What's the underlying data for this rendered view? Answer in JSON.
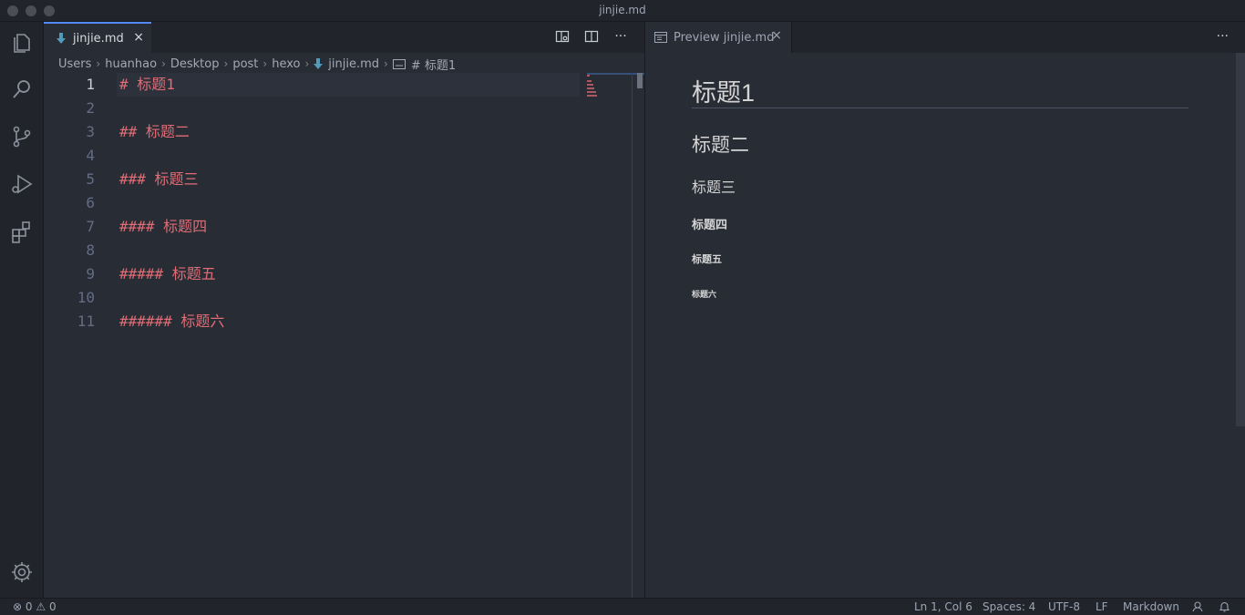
{
  "window": {
    "title": "jinjie.md"
  },
  "activity_bar": {
    "items": [
      "explorer-icon",
      "search-icon",
      "source-control-icon",
      "run-debug-icon",
      "extensions-icon"
    ],
    "bottom": "gear-icon"
  },
  "left_editor": {
    "tab": {
      "label": "jinjie.md",
      "close": "×"
    },
    "more": "···",
    "breadcrumb": {
      "items": [
        "Users",
        "huanhao",
        "Desktop",
        "post",
        "hexo"
      ],
      "file": "jinjie.md",
      "symbol": "# 标题1"
    },
    "lines": [
      {
        "num": "1",
        "text": "# 标题1"
      },
      {
        "num": "2",
        "text": ""
      },
      {
        "num": "3",
        "text": "## 标题二"
      },
      {
        "num": "4",
        "text": ""
      },
      {
        "num": "5",
        "text": "### 标题三"
      },
      {
        "num": "6",
        "text": ""
      },
      {
        "num": "7",
        "text": "#### 标题四"
      },
      {
        "num": "8",
        "text": ""
      },
      {
        "num": "9",
        "text": "##### 标题五"
      },
      {
        "num": "10",
        "text": ""
      },
      {
        "num": "11",
        "text": "###### 标题六"
      }
    ]
  },
  "right_editor": {
    "tab": {
      "label": "Preview jinjie.md",
      "close": "×"
    },
    "more": "···",
    "preview": {
      "h1": "标题1",
      "h2": "标题二",
      "h3": "标题三",
      "h4": "标题四",
      "h5": "标题五",
      "h6": "标题六"
    }
  },
  "status_bar": {
    "errors": "0",
    "warnings": "0",
    "position": "Ln 1, Col 6",
    "spaces": "Spaces: 4",
    "encoding": "UTF-8",
    "eol": "LF",
    "language": "Markdown"
  },
  "colors": {
    "accent": "#528bff",
    "heading_syntax": "#e06c75",
    "md_file_icon": "#519aba"
  }
}
